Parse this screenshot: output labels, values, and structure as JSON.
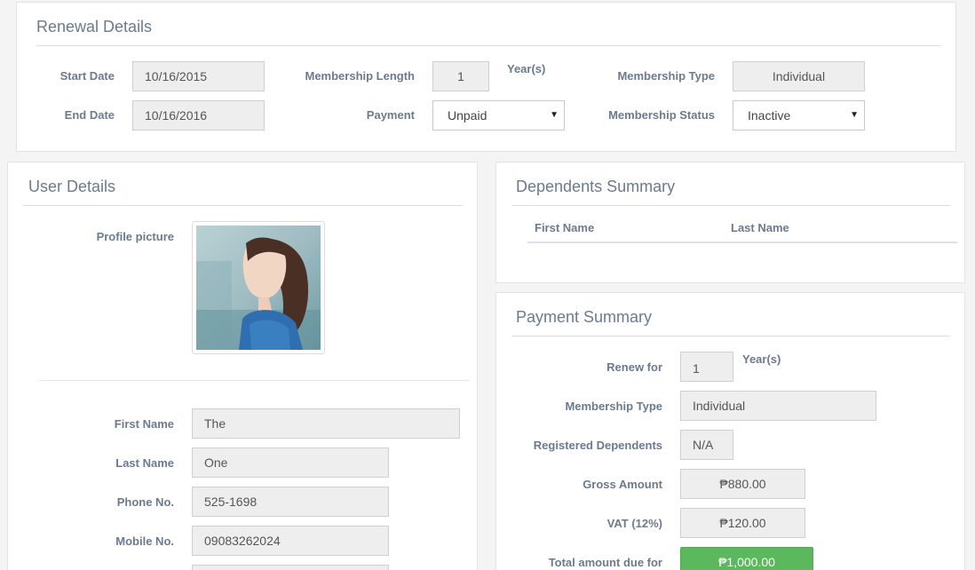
{
  "renewal": {
    "title": "Renewal Details",
    "start_date_label": "Start Date",
    "start_date": "10/16/2015",
    "end_date_label": "End Date",
    "end_date": "10/16/2016",
    "membership_length_label": "Membership Length",
    "membership_length": "1",
    "years_unit": "Year(s)",
    "payment_label": "Payment",
    "payment_value": "Unpaid",
    "membership_type_label": "Membership Type",
    "membership_type": "Individual",
    "membership_status_label": "Membership Status",
    "membership_status": "Inactive"
  },
  "user": {
    "title": "User Details",
    "profile_picture_label": "Profile picture",
    "first_name_label": "First Name",
    "first_name": "The",
    "last_name_label": "Last Name",
    "last_name": "One",
    "phone_label": "Phone No.",
    "phone": "525-1698",
    "mobile_label": "Mobile No.",
    "mobile": "09083262024"
  },
  "dependents": {
    "title": "Dependents Summary",
    "columns": [
      "First Name",
      "Last Name"
    ]
  },
  "payment": {
    "title": "Payment Summary",
    "renew_for_label": "Renew for",
    "renew_for": "1",
    "years_unit": "Year(s)",
    "membership_type_label": "Membership Type",
    "membership_type": "Individual",
    "registered_dependents_label": "Registered Dependents",
    "registered_dependents": "N/A",
    "gross_amount_label": "Gross Amount",
    "gross_amount": "₱880.00",
    "vat_label": "VAT (12%)",
    "vat": "₱120.00",
    "total_label": "Total amount due for",
    "total": "₱1,000.00"
  },
  "colors": {
    "accent_green": "#5cb85c",
    "label": "#6b7a8f"
  }
}
